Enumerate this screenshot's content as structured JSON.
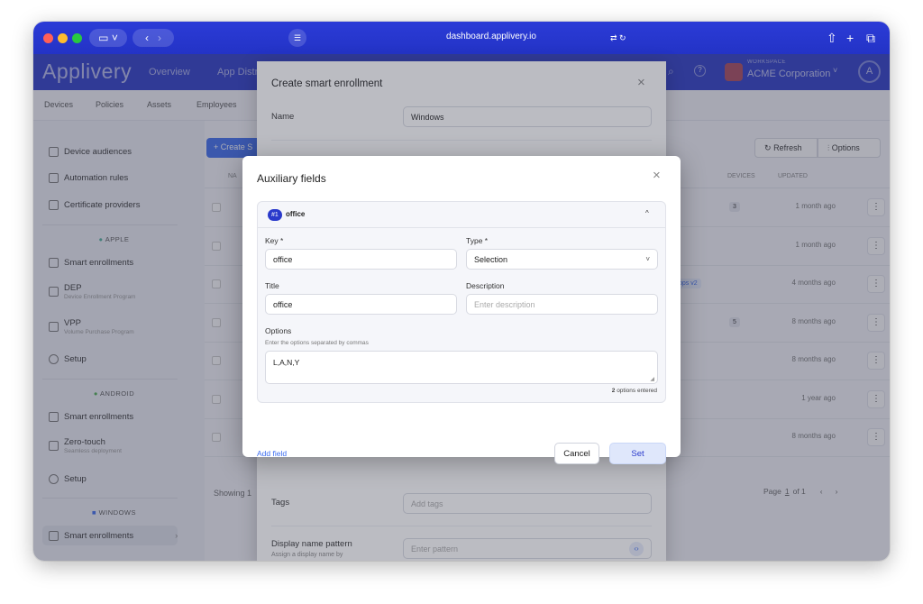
{
  "browser": {
    "url": "dashboard.applivery.io"
  },
  "app": {
    "logo": "Applivery",
    "nav": [
      "Overview",
      "App Distr"
    ],
    "workspace_label": "WORKSPACE",
    "workspace_name": "ACME Corporation"
  },
  "subnav": [
    "Devices",
    "Policies",
    "Assets",
    "Employees"
  ],
  "sidebar": {
    "top": [
      "Device audiences",
      "Automation rules",
      "Certificate providers"
    ],
    "apple_title": "APPLE",
    "apple": [
      {
        "label": "Smart enrollments",
        "sub": ""
      },
      {
        "label": "DEP",
        "sub": "Device Enrollment Program"
      },
      {
        "label": "VPP",
        "sub": "Volume Purchase Program"
      },
      {
        "label": "Setup",
        "sub": ""
      }
    ],
    "android_title": "ANDROID",
    "android": [
      {
        "label": "Smart enrollments",
        "sub": ""
      },
      {
        "label": "Zero-touch",
        "sub": "Seamless deployment"
      },
      {
        "label": "Setup",
        "sub": ""
      }
    ],
    "windows_title": "WINDOWS",
    "windows": [
      {
        "label": "Smart enrollments",
        "sub": ""
      }
    ]
  },
  "table": {
    "create_button": "+ Create S",
    "refresh": "Refresh",
    "options": "Options",
    "col_devices": "DEVICES",
    "col_updated": "UPDATED",
    "col_name": "NA",
    "rows": [
      {
        "devices": "3",
        "updated": "1 month ago"
      },
      {
        "devices": "",
        "updated": "1 month ago"
      },
      {
        "devices": "",
        "badge": "pps v2",
        "updated": "4 months ago"
      },
      {
        "devices": "5",
        "updated": "8 months ago"
      },
      {
        "devices": "",
        "updated": "8 months ago"
      },
      {
        "devices": "",
        "updated": "1 year ago"
      },
      {
        "devices": "",
        "updated": "8 months ago"
      }
    ],
    "showing": "Showing 1",
    "page_label": "Page",
    "page_num": "1",
    "page_of": "of 1"
  },
  "smart_modal": {
    "title": "Create smart enrollment",
    "name_label": "Name",
    "name_value": "Windows",
    "tags_label": "Tags",
    "tags_placeholder": "Add tags",
    "pattern_label": "Display name pattern",
    "pattern_sub": "Assign a display name by",
    "pattern_placeholder": "Enter pattern"
  },
  "aux_modal": {
    "title": "Auxiliary fields",
    "field_badge": "#1",
    "field_name": "office",
    "key_label": "Key *",
    "key_value": "office",
    "type_label": "Type *",
    "type_value": "Selection",
    "title_label": "Title",
    "title_value": "office",
    "desc_label": "Description",
    "desc_placeholder": "Enter description",
    "options_label": "Options",
    "options_hint": "Enter the options separated by commas",
    "options_value": "L,A,N,Y",
    "options_count": "2",
    "options_count_suffix": "options entered",
    "add_field": "Add field",
    "cancel": "Cancel",
    "set": "Set"
  },
  "colors": {
    "brand": "#2a3acb",
    "accent": "#3b6cf0",
    "set_bg": "#dfe7fb"
  }
}
